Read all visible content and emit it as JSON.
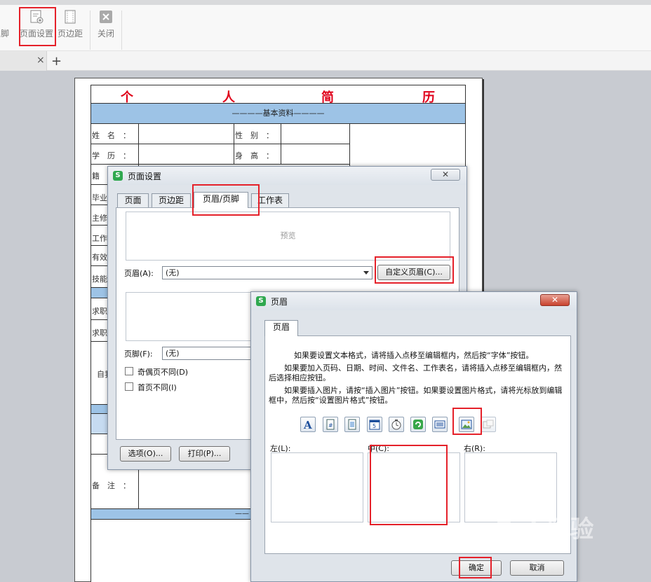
{
  "toolbar": {
    "partial_label": "脚",
    "page_setup_label": "页面设置",
    "margins_label": "页边距",
    "close_label": "关闭"
  },
  "tabbar": {
    "close_glyph": "×",
    "new_tab_glyph": "+"
  },
  "resume": {
    "title_chars": [
      "个",
      "人",
      "简",
      "历"
    ],
    "section_basic": "————基本资料————",
    "rows": {
      "name": "姓　名　：",
      "gender": "性　别　：",
      "education": "学　历　：",
      "height": "身　高　：",
      "r_ji": "籍",
      "r_graduate": "毕业",
      "r_major": "主修",
      "r_work": "工作",
      "r_valid": "有效",
      "r_skill": "技能",
      "r_job1": "求职",
      "r_job2": "求职",
      "r_self": "自我",
      "remarks": "备　注　：",
      "section_bottom": "——"
    }
  },
  "page_setup_dialog": {
    "logo": "S",
    "title": "页面设置",
    "close_glyph": "✕",
    "tabs": [
      "页面",
      "页边距",
      "页眉/页脚",
      "工作表"
    ],
    "active_tab_index": 2,
    "preview_label": "预览",
    "header_label": "页眉(A):",
    "header_value": "(无)",
    "custom_header_button": "自定义页眉(C)...",
    "footer_label": "页脚(F):",
    "footer_value": "(无)",
    "odd_even_label": "奇偶页不同(D)",
    "first_page_label": "首页不同(I)",
    "options_button": "选项(O)...",
    "print_button": "打印(P)..."
  },
  "header_dialog": {
    "logo": "S",
    "title": "页眉",
    "close_glyph": "✕",
    "tab": "页眉",
    "instructions": [
      "如果要设置文本格式，请将插入点移至编辑框内，然后按“字体”按钮。",
      "如果要加入页码、日期、时间、文件名、工作表名，请将插入点移至编辑框内，然后选择相应按钮。",
      "如果要插入图片，请按“插入图片”按钮。如果要设置图片格式，请将光标放到编辑框中，然后按“设置图片格式”按钮。"
    ],
    "left_label": "左(L):",
    "center_label": "中(C):",
    "right_label": "右(R):",
    "ok_button": "确定",
    "cancel_button": "取消",
    "icons": [
      "font-icon",
      "page-number-icon",
      "page-count-icon",
      "date-icon",
      "time-icon",
      "file-name-icon",
      "sheet-name-icon",
      "insert-picture-icon",
      "format-picture-icon"
    ]
  },
  "watermark": "Bai 经验",
  "colors": {
    "annotation_red": "#e5212a",
    "title_red": "#e0001a",
    "section_blue": "#9dc3e6",
    "app_green": "#2fa84f"
  }
}
